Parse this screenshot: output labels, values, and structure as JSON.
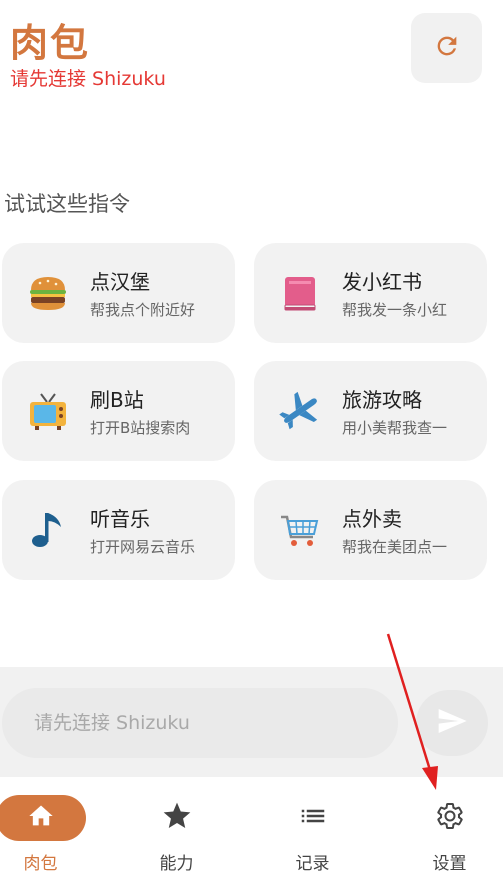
{
  "header": {
    "title": "肉包",
    "status": "请先连接 Shizuku",
    "refresh_icon": "refresh-icon"
  },
  "suggestions": {
    "title": "试试这些指令",
    "items": [
      {
        "icon": "hamburger-icon",
        "title": "点汉堡",
        "subtitle": "帮我点个附近好"
      },
      {
        "icon": "red-book-icon",
        "title": "发小红书",
        "subtitle": "帮我发一条小红"
      },
      {
        "icon": "tv-icon",
        "title": "刷B站",
        "subtitle": "打开B站搜索肉"
      },
      {
        "icon": "airplane-icon",
        "title": "旅游攻略",
        "subtitle": "用小美帮我查一"
      },
      {
        "icon": "music-note-icon",
        "title": "听音乐",
        "subtitle": "打开网易云音乐"
      },
      {
        "icon": "shopping-cart-icon",
        "title": "点外卖",
        "subtitle": "帮我在美团点一"
      }
    ]
  },
  "composer": {
    "placeholder": "请先连接 Shizuku",
    "send_icon": "send-icon"
  },
  "nav": {
    "items": [
      {
        "label": "肉包",
        "icon": "home-icon",
        "active": true
      },
      {
        "label": "能力",
        "icon": "star-icon",
        "active": false
      },
      {
        "label": "记录",
        "icon": "list-icon",
        "active": false
      },
      {
        "label": "设置",
        "icon": "gear-icon",
        "active": false
      }
    ]
  },
  "colors": {
    "accent": "#d3773f",
    "error": "#e53935",
    "card_bg": "#f2f2f2"
  }
}
